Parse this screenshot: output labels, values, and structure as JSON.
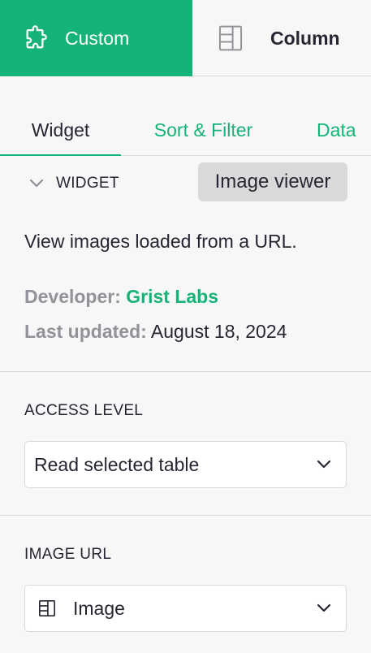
{
  "top_tabs": [
    {
      "label": "Custom",
      "icon": "puzzle-icon",
      "active": true
    },
    {
      "label": "Column",
      "icon": "column-icon",
      "active": false
    }
  ],
  "sub_tabs": [
    {
      "label": "Widget",
      "active": true
    },
    {
      "label": "Sort & Filter",
      "active": false
    },
    {
      "label": "Data",
      "active": false
    }
  ],
  "widget_section": {
    "title": "WIDGET",
    "selected_widget": "Image viewer",
    "description": "View images loaded from a URL.",
    "developer_label": "Developer:",
    "developer_name": "Grist Labs",
    "updated_label": "Last updated:",
    "updated_date": "August 18, 2024"
  },
  "access_level": {
    "label": "ACCESS LEVEL",
    "value": "Read selected table"
  },
  "image_url": {
    "label": "IMAGE URL",
    "value": "Image",
    "icon": "column-icon"
  },
  "colors": {
    "accent": "#16b378",
    "muted": "#929299",
    "background": "#f7f7f7"
  }
}
